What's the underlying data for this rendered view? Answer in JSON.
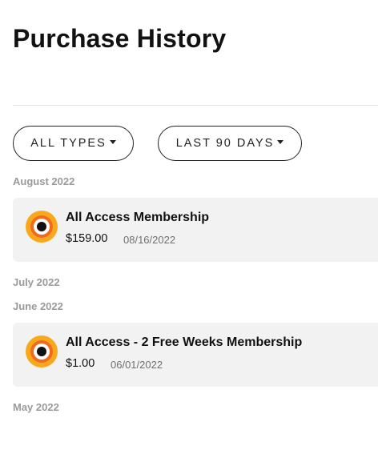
{
  "page": {
    "title": "Purchase History"
  },
  "filters": {
    "types_label": "ALL TYPES",
    "range_label": "LAST 90 DAYS"
  },
  "sections": [
    {
      "month": "August 2022",
      "purchases": [
        {
          "name": "All Access Membership",
          "price": "$159.00",
          "date": "08/16/2022",
          "icon": "brand-logo-icon"
        }
      ]
    },
    {
      "month": "July 2022",
      "purchases": []
    },
    {
      "month": "June 2022",
      "purchases": [
        {
          "name": "All Access - 2 Free Weeks Membership",
          "price": "$1.00",
          "date": "06/01/2022",
          "icon": "brand-logo-icon"
        }
      ]
    },
    {
      "month": "May 2022",
      "purchases": []
    }
  ],
  "colors": {
    "logo_outer": "#f7a81b",
    "logo_ring": "#f26a21",
    "card_background": "#f2f2f2",
    "section_label": "#9a9a9a"
  }
}
